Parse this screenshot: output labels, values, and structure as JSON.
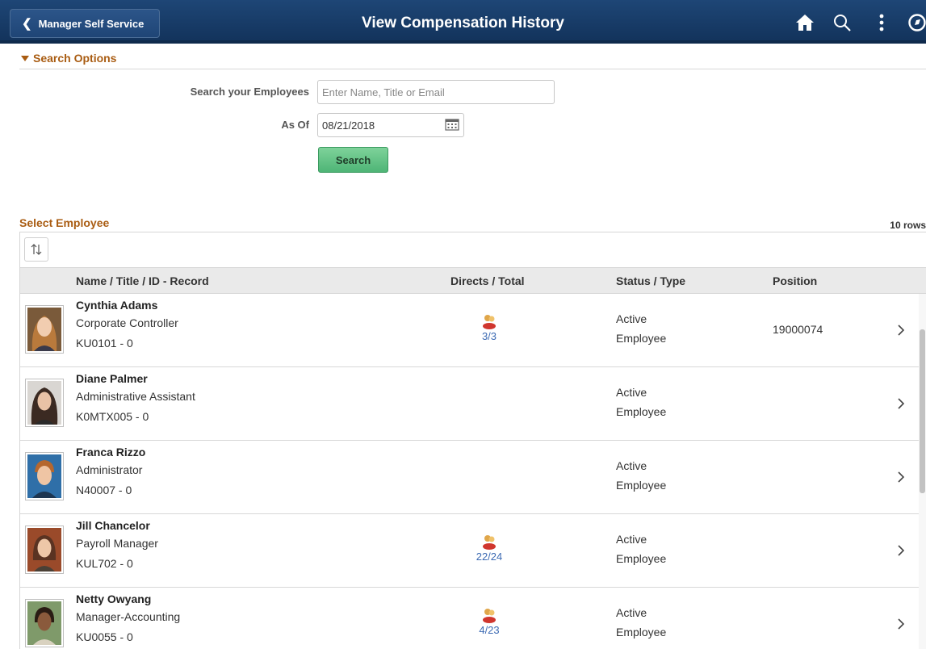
{
  "header": {
    "back_label": "Manager Self Service",
    "title": "View Compensation History",
    "icons": [
      "home-icon",
      "search-icon",
      "more-icon",
      "navbar-icon"
    ]
  },
  "search_options": {
    "section_label": "Search Options",
    "employee_label": "Search your Employees",
    "employee_placeholder": "Enter Name, Title or Email",
    "employee_value": "",
    "asof_label": "As Of",
    "asof_value": "08/21/2018",
    "search_button": "Search"
  },
  "grid": {
    "title": "Select Employee",
    "row_count": "10 rows",
    "columns": [
      "Name / Title / ID - Record",
      "Directs / Total",
      "Status / Type",
      "Position"
    ],
    "rows": [
      {
        "name": "Cynthia Adams",
        "title": "Corporate Controller",
        "id": "KU0101 - 0",
        "directs": "3/3",
        "status": "Active",
        "type": "Employee",
        "position": "19000074"
      },
      {
        "name": "Diane Palmer",
        "title": "Administrative Assistant",
        "id": "K0MTX005 - 0",
        "directs": "",
        "status": "Active",
        "type": "Employee",
        "position": ""
      },
      {
        "name": "Franca Rizzo",
        "title": "Administrator",
        "id": "N40007 - 0",
        "directs": "",
        "status": "Active",
        "type": "Employee",
        "position": ""
      },
      {
        "name": "Jill Chancelor",
        "title": "Payroll Manager",
        "id": "KUL702 - 0",
        "directs": "22/24",
        "status": "Active",
        "type": "Employee",
        "position": ""
      },
      {
        "name": "Netty Owyang",
        "title": "Manager-Accounting",
        "id": "KU0055 - 0",
        "directs": "4/23",
        "status": "Active",
        "type": "Employee",
        "position": ""
      }
    ]
  },
  "colors": {
    "banner": "#1e4676",
    "section_heading": "#a95c12",
    "search_button": "#5cbf82",
    "link": "#3c6ab3"
  }
}
